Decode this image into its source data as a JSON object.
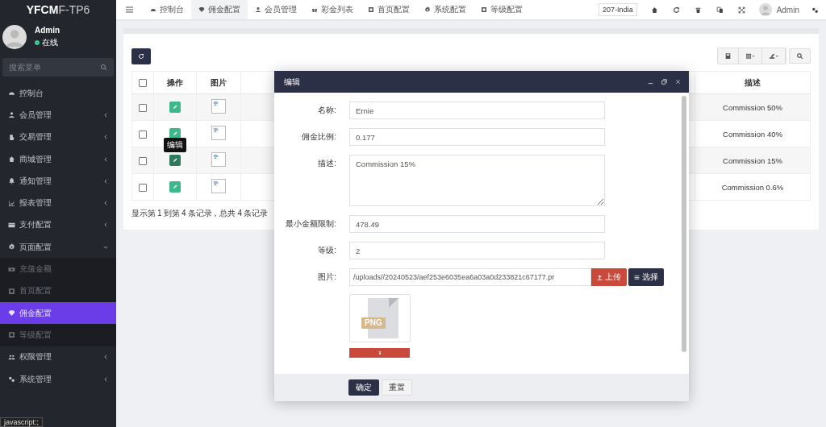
{
  "brand": "**YFCM**F-TP6",
  "user": {
    "name": "Admin",
    "status": "在线"
  },
  "menu_search": {
    "placeholder": "搜索菜单"
  },
  "sidebar": {
    "items": [
      {
        "kind": "link",
        "label": "控制台"
      },
      {
        "kind": "group",
        "label": "会员管理",
        "expanded": false
      },
      {
        "kind": "group",
        "label": "交易管理",
        "expanded": false
      },
      {
        "kind": "group",
        "label": "商城管理",
        "expanded": false
      },
      {
        "kind": "group",
        "label": "通知管理",
        "expanded": false
      },
      {
        "kind": "group",
        "label": "报表管理",
        "expanded": false
      },
      {
        "kind": "group",
        "label": "支付配置",
        "expanded": false
      },
      {
        "kind": "group",
        "label": "页面配置",
        "expanded": true,
        "children": [
          {
            "label": "充值金额",
            "selected": false
          },
          {
            "label": "首页配置",
            "selected": false
          },
          {
            "label": "佣金配置",
            "selected": true
          },
          {
            "label": "等级配置",
            "selected": false
          }
        ]
      },
      {
        "kind": "group",
        "label": "权限管理",
        "expanded": false
      },
      {
        "kind": "group",
        "label": "系统管理",
        "expanded": false
      }
    ]
  },
  "status_bar": {
    "text": "javascript:;"
  },
  "tabs": [
    {
      "label": "控制台",
      "selected": false
    },
    {
      "label": "佣金配置",
      "selected": true
    },
    {
      "label": "会员管理",
      "selected": false
    },
    {
      "label": "彩金列表",
      "selected": false
    },
    {
      "label": "首页配置",
      "selected": false
    },
    {
      "label": "系统配置",
      "selected": false
    },
    {
      "label": "等级配置",
      "selected": false
    }
  ],
  "site_selector": "207-India",
  "top_user": "Admin",
  "table": {
    "select_all": {
      "checked": false
    },
    "columns": [
      "操作",
      "图片",
      "描述"
    ],
    "rows": [
      {
        "checked": false,
        "hover": false,
        "description": "Commission 50%"
      },
      {
        "checked": false,
        "hover": false,
        "description": "Commission 40%"
      },
      {
        "checked": false,
        "hover": true,
        "description": "Commission 15%"
      },
      {
        "checked": false,
        "hover": false,
        "description": "Commission 0.6%"
      }
    ],
    "tooltip": "编辑",
    "summary": "显示第 1 到第 4 条记录，总共 4 条记录"
  },
  "dialog": {
    "title": "编辑",
    "fields": [
      {
        "kind": "text",
        "label": "名称:",
        "value": "Ernie"
      },
      {
        "kind": "text",
        "label": "佣金比例:",
        "value": "0.177"
      },
      {
        "kind": "textarea",
        "label": "描述:",
        "value": "Commission 15%"
      },
      {
        "kind": "text",
        "label": "最小金额限制:",
        "value": "478.49"
      },
      {
        "kind": "text",
        "label": "等级:",
        "value": "2"
      },
      {
        "kind": "image",
        "label": "图片:",
        "value": "/uploads//20240523/aef253e6035ea6a03a0d233821c67177.pr",
        "upload": "上传",
        "choose": "选择",
        "preview": "PNG"
      }
    ],
    "buttons": [
      "确定",
      "重置"
    ]
  }
}
